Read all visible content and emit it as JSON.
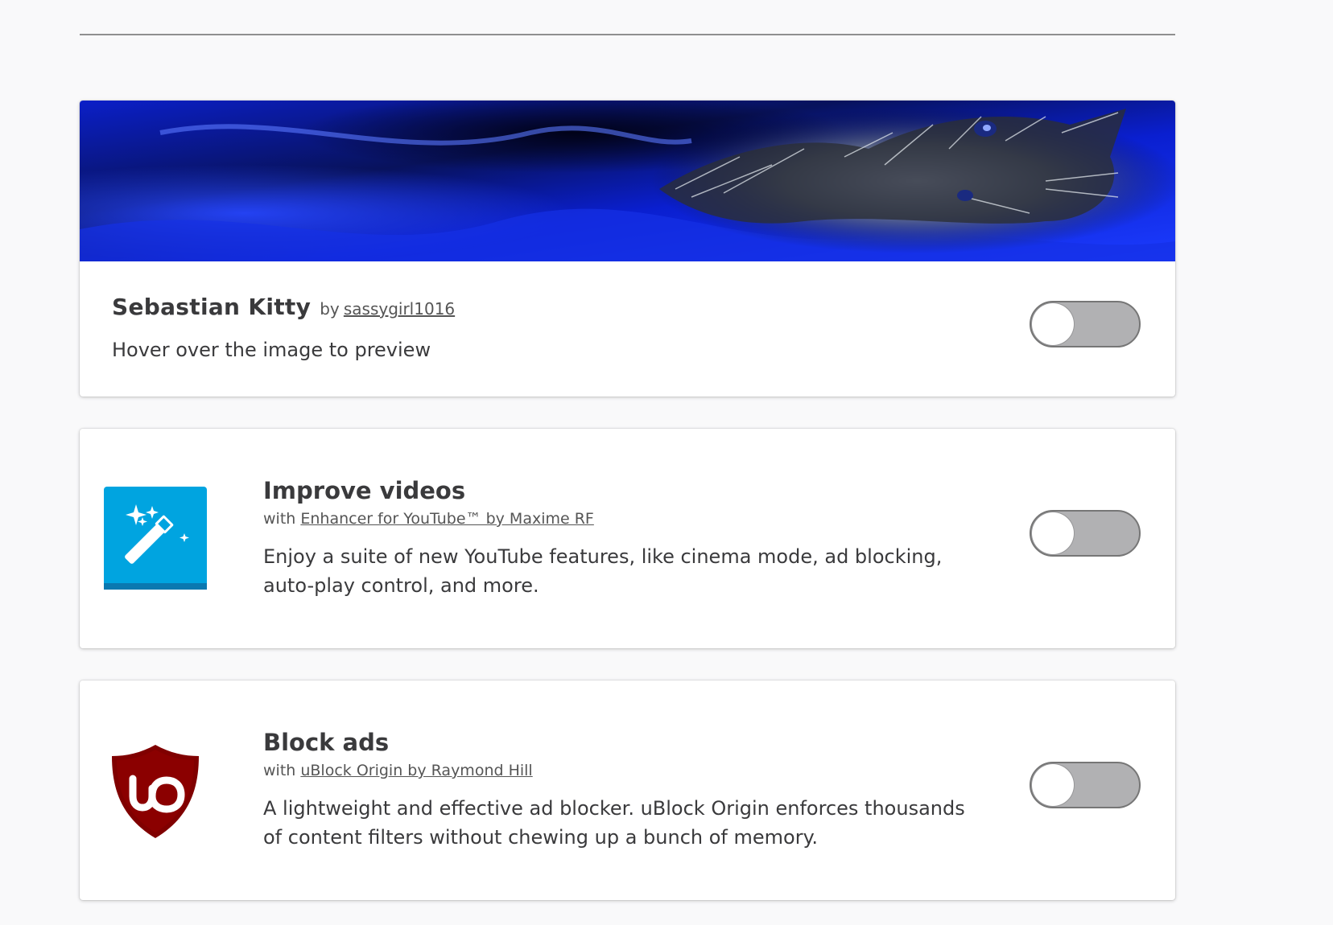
{
  "theme": {
    "name": "Sebastian Kitty",
    "by": "by",
    "author": "sassygirl1016",
    "description": "Hover over the image to preview",
    "enabled": false
  },
  "features": [
    {
      "title": "Improve videos",
      "with": "with",
      "link": "Enhancer for YouTube™ by Maxime RF",
      "description": "Enjoy a suite of new YouTube features, like cinema mode, ad blocking, auto-play control, and more.",
      "icon": "magic-wand-icon",
      "icon_color": "#00a4e0",
      "enabled": false
    },
    {
      "title": "Block ads",
      "with": "with",
      "link": "uBlock Origin by Raymond Hill",
      "description": "A lightweight and effective ad blocker. uBlock Origin enforces thousands of content filters without chewing up a bunch of memory.",
      "icon": "ublock-shield-icon",
      "icon_color": "#800000",
      "enabled": false
    }
  ],
  "colors": {
    "background": "#f9f9fa",
    "card": "#ffffff",
    "toggle_off": "#b1b1b3",
    "text": "#3a3a3c"
  }
}
